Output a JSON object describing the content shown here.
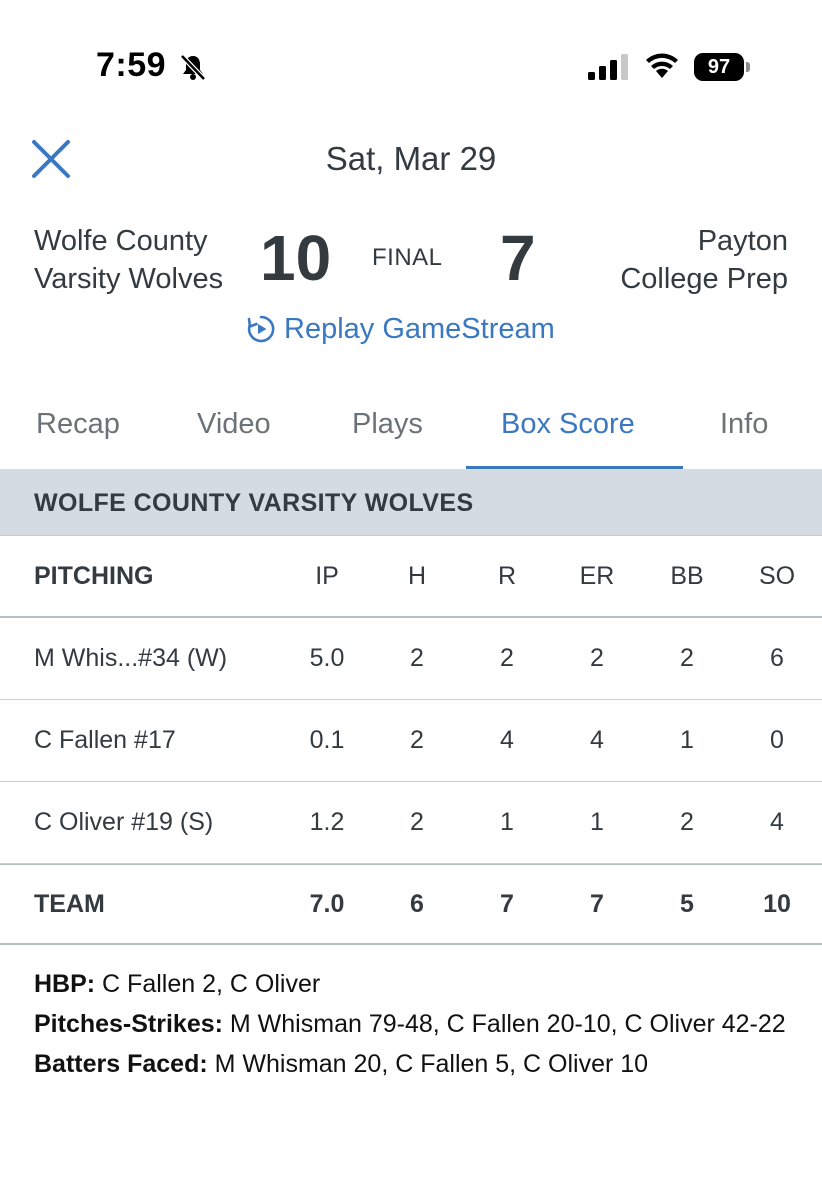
{
  "status_bar": {
    "time": "7:59",
    "battery": "97",
    "icons": [
      "bell-slash-icon",
      "cellular-signal-icon",
      "wifi-icon",
      "battery-icon"
    ]
  },
  "header": {
    "date": "Sat, Mar 29",
    "close_icon": "close-icon"
  },
  "game": {
    "home_team_line1": "Wolfe County",
    "home_team_line2": "Varsity Wolves",
    "home_score": "10",
    "status": "FINAL",
    "away_score": "7",
    "away_team_line1": "Payton",
    "away_team_line2": "College Prep",
    "replay_label": "Replay GameStream",
    "replay_icon": "replay-play-icon"
  },
  "tabs": [
    {
      "label": "Recap",
      "active": false
    },
    {
      "label": "Video",
      "active": false
    },
    {
      "label": "Plays",
      "active": false
    },
    {
      "label": "Box Score",
      "active": true
    },
    {
      "label": "Info",
      "active": false
    }
  ],
  "box_score": {
    "team_name": "WOLFE COUNTY VARSITY WOLVES",
    "columns": [
      "PITCHING",
      "IP",
      "H",
      "R",
      "ER",
      "BB",
      "SO"
    ],
    "rows": [
      {
        "name": "M Whis...#34 (W)",
        "ip": "5.0",
        "h": "2",
        "r": "2",
        "er": "2",
        "bb": "2",
        "so": "6"
      },
      {
        "name": "C Fallen #17",
        "ip": "0.1",
        "h": "2",
        "r": "4",
        "er": "4",
        "bb": "1",
        "so": "0"
      },
      {
        "name": "C Oliver #19 (S)",
        "ip": "1.2",
        "h": "2",
        "r": "1",
        "er": "1",
        "bb": "2",
        "so": "4"
      }
    ],
    "team_total": {
      "name": "TEAM",
      "ip": "7.0",
      "h": "6",
      "r": "7",
      "er": "7",
      "bb": "5",
      "so": "10"
    }
  },
  "notes": [
    {
      "label": "HBP:",
      "text": " C Fallen 2, C Oliver"
    },
    {
      "label": "Pitches-Strikes:",
      "text": " M Whisman 79-48, C Fallen 20-10, C Oliver 42-22"
    },
    {
      "label": "Batters Faced:",
      "text": " M Whisman 20, C Fallen 5, C Oliver 10"
    }
  ],
  "colors": {
    "accent": "#3a78c2",
    "text": "#333a40",
    "band": "#d4dbe2"
  }
}
